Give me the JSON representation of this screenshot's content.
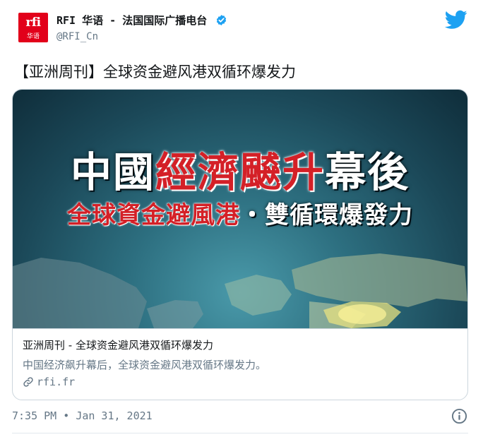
{
  "author": {
    "avatar_logo": "rfi",
    "avatar_sub": "华语",
    "name": "RFI 华语 - 法国国际广播电台",
    "handle": "@RFI_Cn",
    "verified": true,
    "icons": {
      "verified": "verified-badge-icon",
      "platform": "twitter-bird-icon"
    }
  },
  "tweet": {
    "text": "【亚洲周刊】全球资金避风港双循环爆发力"
  },
  "card": {
    "image": {
      "headline_white": "中國",
      "headline_red": "經濟飇升",
      "headline_white_end": "幕後",
      "sub_red": "全球資金避風港",
      "sub_white": "・雙循環爆發力"
    },
    "title": "亚洲周刊 - 全球资金避风港双循环爆发力",
    "description": "中国经济飙升幕后，全球资金避风港双循环爆发力。",
    "link": "rfi.fr",
    "link_icon": "link-icon"
  },
  "meta": {
    "time": "7:35 PM",
    "separator": "•",
    "date": "Jan 31, 2021",
    "info_icon": "info-icon"
  },
  "colors": {
    "brand_red": "#e2001a",
    "twitter_blue": "#1da1f2",
    "headline_red": "#d42027",
    "secondary_text": "#657786"
  }
}
